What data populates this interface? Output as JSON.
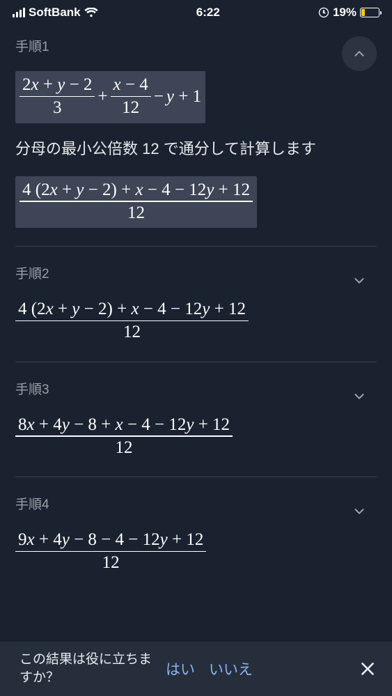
{
  "status_bar": {
    "carrier": "SoftBank",
    "time": "6:22",
    "battery_pct": "19%",
    "battery_fill_pct": 19
  },
  "steps": [
    {
      "label": "手順1",
      "expanded": true,
      "expr1": {
        "frac1_num": "2x + y − 2",
        "frac1_den": "3",
        "frac2_num": "x − 4",
        "frac2_den": "12",
        "tail": "− y + 1"
      },
      "explain": "分母の最小公倍数 12 で通分して計算します",
      "expr2": {
        "num": "4 (2x + y − 2) + x − 4 − 12y + 12",
        "den": "12"
      }
    },
    {
      "label": "手順2",
      "expanded": false,
      "expr": {
        "num": "4 (2x + y − 2) + x − 4 − 12y + 12",
        "den": "12"
      }
    },
    {
      "label": "手順3",
      "expanded": false,
      "expr": {
        "num": "8x + 4y − 8 + x − 4 − 12y + 12",
        "den": "12"
      }
    },
    {
      "label": "手順4",
      "expanded": false,
      "expr": {
        "num": "9x + 4y − 8 − 4 − 12y + 12",
        "den": "12"
      }
    }
  ],
  "feedback": {
    "question": "この結果は役に立ちますか？",
    "yes": "はい",
    "no": "いいえ"
  }
}
